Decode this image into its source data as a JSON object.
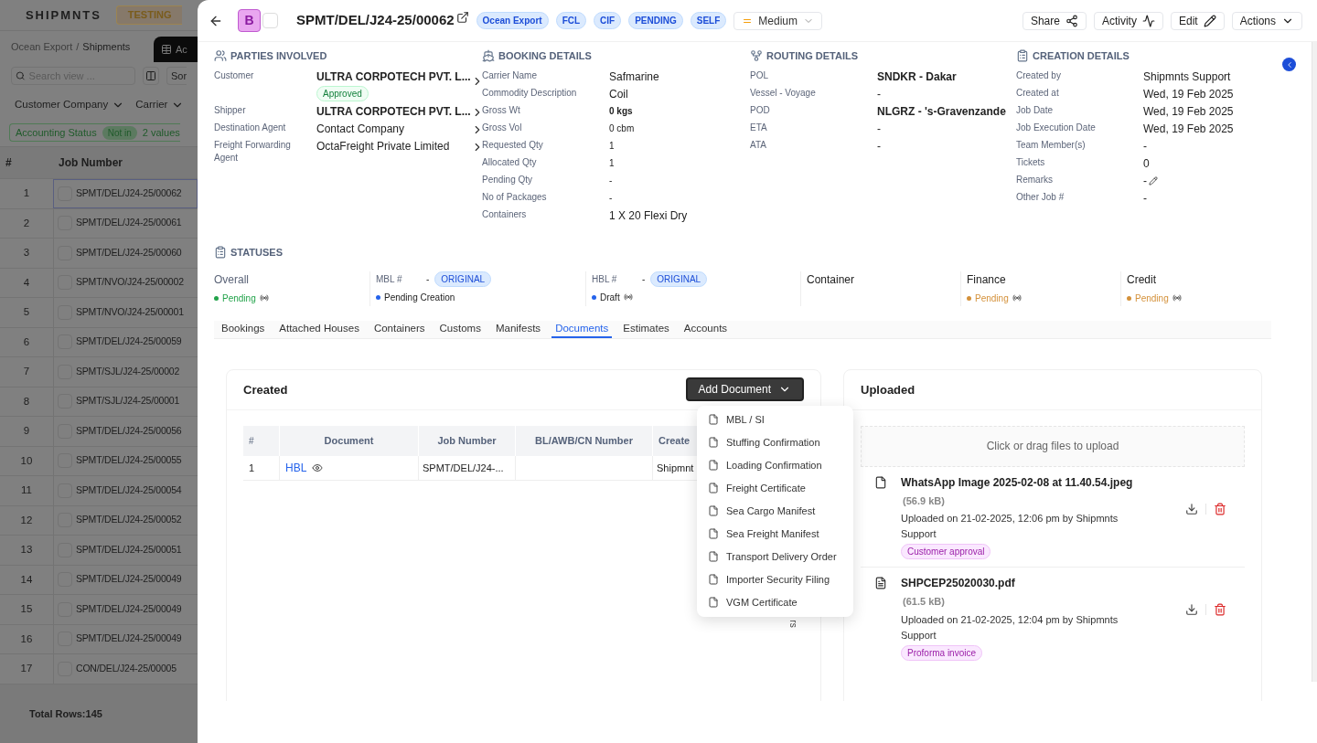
{
  "background_app": {
    "brand": "SHIPMNTS",
    "env_badge": "TESTING",
    "breadcrumb": [
      "Ocean Export",
      "Shipments"
    ],
    "breadcrumb_separator": "/",
    "view_tab": "Ac",
    "search": {
      "placeholder": "Search view ..."
    },
    "sort_button": "Sor",
    "filters": [
      "Customer Company",
      "Carrier"
    ],
    "filter_chip": {
      "field": "Accounting Status",
      "operator": "Not in",
      "value": "2 values"
    },
    "table": {
      "columns": [
        "#",
        "Job Number"
      ],
      "rows": [
        {
          "index": "1",
          "job_number": "SPMT/DEL/J24-25/00062",
          "selected": true
        },
        {
          "index": "2",
          "job_number": "SPMT/DEL/J24-25/00061",
          "selected": false
        },
        {
          "index": "3",
          "job_number": "SPMT/DEL/J24-25/00060",
          "selected": false
        },
        {
          "index": "4",
          "job_number": "SPMT/NVO/J24-25/00002",
          "selected": false
        },
        {
          "index": "5",
          "job_number": "SPMT/NVO/J24-25/00001",
          "selected": false
        },
        {
          "index": "6",
          "job_number": "SPMT/DEL/J24-25/00059",
          "selected": false
        },
        {
          "index": "7",
          "job_number": "SPMT/SJL/J24-25/00002",
          "selected": false
        },
        {
          "index": "8",
          "job_number": "SPMT/SJL/J24-25/00001",
          "selected": false
        },
        {
          "index": "9",
          "job_number": "SPMT/DEL/J24-25/00056",
          "selected": false
        },
        {
          "index": "10",
          "job_number": "SPMT/DEL/J24-25/00055",
          "selected": false
        },
        {
          "index": "11",
          "job_number": "SPMT/DEL/J24-25/00054",
          "selected": false
        },
        {
          "index": "12",
          "job_number": "SPMT/DEL/J24-25/00052",
          "selected": false
        },
        {
          "index": "13",
          "job_number": "SPMT/DEL/J24-25/00051",
          "selected": false
        },
        {
          "index": "14",
          "job_number": "SPMT/DEL/J24-25/00049",
          "selected": false
        },
        {
          "index": "15",
          "job_number": "SPMT/DEL/J24-25/00049",
          "selected": false
        },
        {
          "index": "16",
          "job_number": "SPMT/DEL/J24-25/00049",
          "selected": false
        },
        {
          "index": "17",
          "job_number": "CON/DEL/J24-25/00005",
          "selected": false
        }
      ]
    },
    "footer": "Total Rows:145"
  },
  "drawer": {
    "header": {
      "avatar": "B",
      "checked": false,
      "title": "SPMT/DEL/J24-25/00062",
      "tags": [
        "Ocean Export",
        "FCL",
        "CIF",
        "PENDING",
        "SELF"
      ],
      "priority": "Medium",
      "actions": [
        {
          "label": "Share",
          "kind": "share"
        },
        {
          "label": "Activity",
          "kind": "activity"
        },
        {
          "label": "Edit",
          "kind": "edit"
        },
        {
          "label": "Actions",
          "kind": "menu"
        }
      ]
    },
    "sections": [
      {
        "title": "PARTIES INVOLVED",
        "kind": "parties",
        "fields": [
          {
            "label": "Customer",
            "value": "ULTRA CORPOTECH PVT. L...",
            "bold": true,
            "badge": "Approved",
            "link": true
          },
          {
            "label": "Shipper",
            "value": "ULTRA CORPOTECH PVT. L...",
            "bold": true,
            "link": true
          },
          {
            "label": "Destination Agent",
            "value": "Contact Company",
            "bold": false,
            "link": true
          },
          {
            "label": "Freight Forwarding Agent",
            "value": "OctaFreight Private Limited",
            "bold": false,
            "link": true
          }
        ]
      },
      {
        "title": "BOOKING DETAILS",
        "kind": "booking",
        "fields": [
          {
            "label": "Carrier Name",
            "value": "Safmarine",
            "bold": false
          },
          {
            "label": "Commodity Description",
            "value": "Coil",
            "bold": false
          },
          {
            "label": "Gross Wt",
            "value": "0 kgs",
            "bold": true
          },
          {
            "label": "Gross Vol",
            "value": "0 cbm",
            "bold": false
          },
          {
            "label": "Requested Qty",
            "value": "1",
            "bold": false
          },
          {
            "label": "Allocated Qty",
            "value": "1",
            "bold": false
          },
          {
            "label": "Pending Qty",
            "value": "-",
            "bold": false
          },
          {
            "label": "No of Packages",
            "value": "-",
            "bold": false
          },
          {
            "label": "Containers",
            "value": "1 X 20 Flexi Dry",
            "bold": false
          }
        ]
      },
      {
        "title": "ROUTING DETAILS",
        "kind": "routing",
        "fields": [
          {
            "label": "POL",
            "value": "SNDKR - Dakar",
            "bold": true
          },
          {
            "label": "Vessel - Voyage",
            "value": "-",
            "bold": false
          },
          {
            "label": "POD",
            "value": "NLGRZ - 's-Gravenzande",
            "bold": true
          },
          {
            "label": "ETA",
            "value": "-",
            "bold": false
          },
          {
            "label": "ATA",
            "value": "-",
            "bold": false
          }
        ]
      },
      {
        "title": "CREATION DETAILS",
        "kind": "creation",
        "fields": [
          {
            "label": "Created by",
            "value": "Shipmnts Support",
            "bold": false
          },
          {
            "label": "Created at",
            "value": "Wed, 19 Feb 2025",
            "bold": false
          },
          {
            "label": "Job Date",
            "value": "Wed, 19 Feb 2025",
            "bold": false
          },
          {
            "label": "Job Execution Date",
            "value": "Wed, 19 Feb 2025",
            "bold": false
          },
          {
            "label": "Team Member(s)",
            "value": "-",
            "bold": false
          },
          {
            "label": "Tickets",
            "value": "0",
            "bold": false
          },
          {
            "label": "Remarks",
            "value": "-",
            "bold": false,
            "editable": true
          },
          {
            "label": "Other Job #",
            "value": "-",
            "bold": false
          }
        ]
      }
    ],
    "statuses": {
      "title": "STATUSES",
      "items": [
        {
          "kind": "status",
          "label": "Overall",
          "status": "Pending",
          "color": "#22a34a",
          "signal": true
        },
        {
          "kind": "document",
          "label": "MBL #",
          "number": "-",
          "badge": "ORIGINAL",
          "status": "Pending Creation",
          "color": "#2563eb",
          "signal": false
        },
        {
          "kind": "document",
          "label": "HBL #",
          "number": "-",
          "badge": "ORIGINAL",
          "status": "Draft",
          "color": "#2563eb",
          "signal": true
        },
        {
          "kind": "status",
          "label": "Container"
        },
        {
          "kind": "status",
          "label": "Finance",
          "status": "Pending",
          "color": "#d4913a",
          "signal": true
        },
        {
          "kind": "status",
          "label": "Credit",
          "status": "Pending",
          "color": "#d4913a",
          "signal": true
        }
      ]
    },
    "tabs": [
      {
        "label": "Bookings",
        "selected": false
      },
      {
        "label": "Attached Houses",
        "selected": false
      },
      {
        "label": "Containers",
        "selected": false
      },
      {
        "label": "Customs",
        "selected": false
      },
      {
        "label": "Manifests",
        "selected": false
      },
      {
        "label": "Documents",
        "selected": true
      },
      {
        "label": "Estimates",
        "selected": false
      },
      {
        "label": "Accounts",
        "selected": false
      }
    ],
    "created": {
      "title": "Created",
      "add_button": "Add Document",
      "columns": [
        "#",
        "Document",
        "Job Number",
        "BL/AWB/CN Number",
        "Create"
      ],
      "rows": [
        {
          "index": "1",
          "document": "HBL",
          "job_number": "SPMT/DEL/J24-...",
          "column_5": "Shipmnt"
        }
      ],
      "hidden_fragment": "rs",
      "menu": [
        "MBL / SI",
        "Stuffing Confirmation",
        "Loading Confirmation",
        "Freight Certificate",
        "Sea Cargo Manifest",
        "Sea Freight Manifest",
        "Transport Delivery Order",
        "Importer Security Filing",
        "VGM Certificate"
      ]
    },
    "uploaded": {
      "title": "Uploaded",
      "dropzone": "Click or drag files to upload",
      "files": [
        {
          "kind": "image",
          "name": "WhatsApp Image 2025-02-08 at 11.40.54.jpeg",
          "size": "(56.9 kB)",
          "uploaded": "Uploaded on 21-02-2025, 12:06 pm by Shipmnts Support",
          "tag": "Customer approval"
        },
        {
          "kind": "pdf",
          "name": "SHPCEP25020030.pdf",
          "size": "(61.5 kB)",
          "uploaded": "Uploaded on 21-02-2025, 12:04 pm by Shipmnts Support",
          "tag": "Proforma invoice"
        }
      ]
    }
  }
}
